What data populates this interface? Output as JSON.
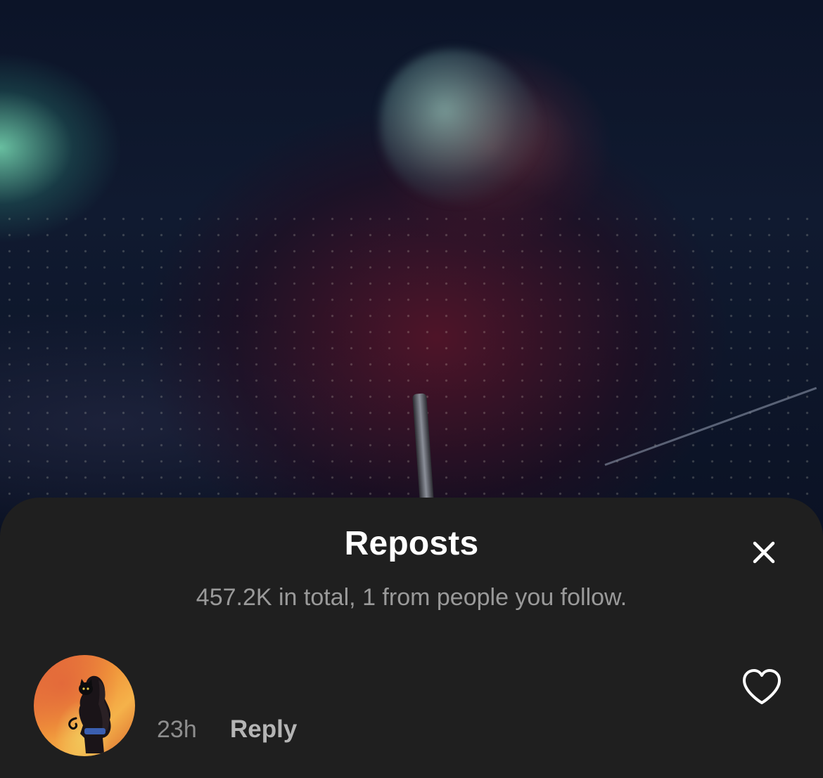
{
  "background": {
    "description_icon": "concert-video-frame"
  },
  "sheet": {
    "title": "Reposts",
    "close_icon": "close-icon",
    "summary": "457.2K in total, 1 from people you follow."
  },
  "reposts": [
    {
      "username": "",
      "time": "23h",
      "reply_label": "Reply",
      "like_icon": "heart-outline-icon",
      "avatar_icon": "avatar-image"
    }
  ],
  "colors": {
    "sheet_background": "#1f1f1f",
    "title": "#ffffff",
    "subtitle": "#9a9a9a",
    "time": "#8e8e8e",
    "reply": "#b5b5b5"
  }
}
